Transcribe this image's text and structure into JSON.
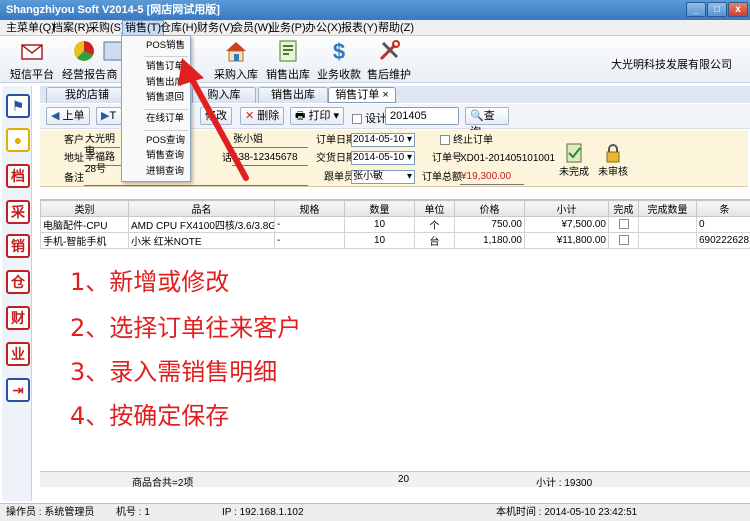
{
  "window": {
    "title": "Shangzhiyou Soft V2014-5 [网店网试用版]"
  },
  "menu": [
    "主菜单(Q)",
    "档案(R)",
    "采购(S)",
    "销售(T)",
    "仓库(H)",
    "财务(V)",
    "会员(W)",
    "业务(P)",
    "办公(X)",
    "报表(Y)",
    "帮助(Z)"
  ],
  "dropdown": [
    "POS销售",
    "销售订单",
    "销售出库",
    "销售退回",
    "在线订单",
    "POS查询",
    "销售查询",
    "进销查询"
  ],
  "toolbar": [
    "短信平台",
    "经营报告",
    "商",
    "采购入库",
    "销售出库",
    "业务收款",
    "售后维护"
  ],
  "company": "大光明科技发展有限公司",
  "tabs": [
    "我的店铺",
    "购入库",
    "销售出库",
    "销售订单"
  ],
  "nav": {
    "prev": "上单",
    "t": "T",
    "modify": "修改",
    "delete": "删除",
    "print": "打印",
    "design": "设计",
    "search_value": "201405",
    "search": "查询"
  },
  "form": {
    "customer_label": "客户",
    "customer": "大光明电",
    "address_label": "地址",
    "address": "幸福路28号",
    "remark_label": "备注",
    "contact": "张小姐",
    "phone_suffix": "话",
    "phone": "138-12345678",
    "order_date_label": "订单日期",
    "order_date": "2014-05-10",
    "deal_date_label": "交货日期",
    "deal_date": "2014-05-10",
    "maker_label": "跟单员",
    "maker": "张小敏",
    "stop_label": "终止订单",
    "order_no_label": "订单号",
    "order_no": "XD01-201405101001",
    "total_label": "订单总额",
    "total": "¥19,300.00",
    "unfinished": "未完成",
    "unaudited": "未审核"
  },
  "grid": {
    "headers": [
      "类别",
      "品名",
      "规格",
      "数量",
      "单位",
      "价格",
      "小计",
      "完成",
      "完成数量",
      "条"
    ],
    "rows": [
      [
        "电脑配件-CPU",
        "AMD CPU FX4100四核/3.6/3.8GHz/",
        "-",
        "10",
        "个",
        "750.00",
        "¥7,500.00",
        "",
        "",
        "0"
      ],
      [
        "手机-智能手机",
        "小米 红米NOTE",
        "-",
        "10",
        "台",
        "1,180.00",
        "¥11,800.00",
        "",
        "",
        "690222628"
      ]
    ]
  },
  "notes": [
    "1、新增或修改",
    "2、选择订单往来客户",
    "3、录入需销售明细",
    "4、按确定保存"
  ],
  "footer": {
    "count": "商品合共=2项",
    "qty": "20",
    "subtotal": "小计 : 19300"
  },
  "status": {
    "operator": "操作员 : 系统管理员",
    "machine": "机号 : 1",
    "ip": "IP : 192.168.1.102",
    "time": "本机时间 : 2014-05-10 23:42:51"
  },
  "colors": {
    "accent": "#3a78bf",
    "note_red": "#e02020",
    "form_bg": "#fdf4dc"
  }
}
